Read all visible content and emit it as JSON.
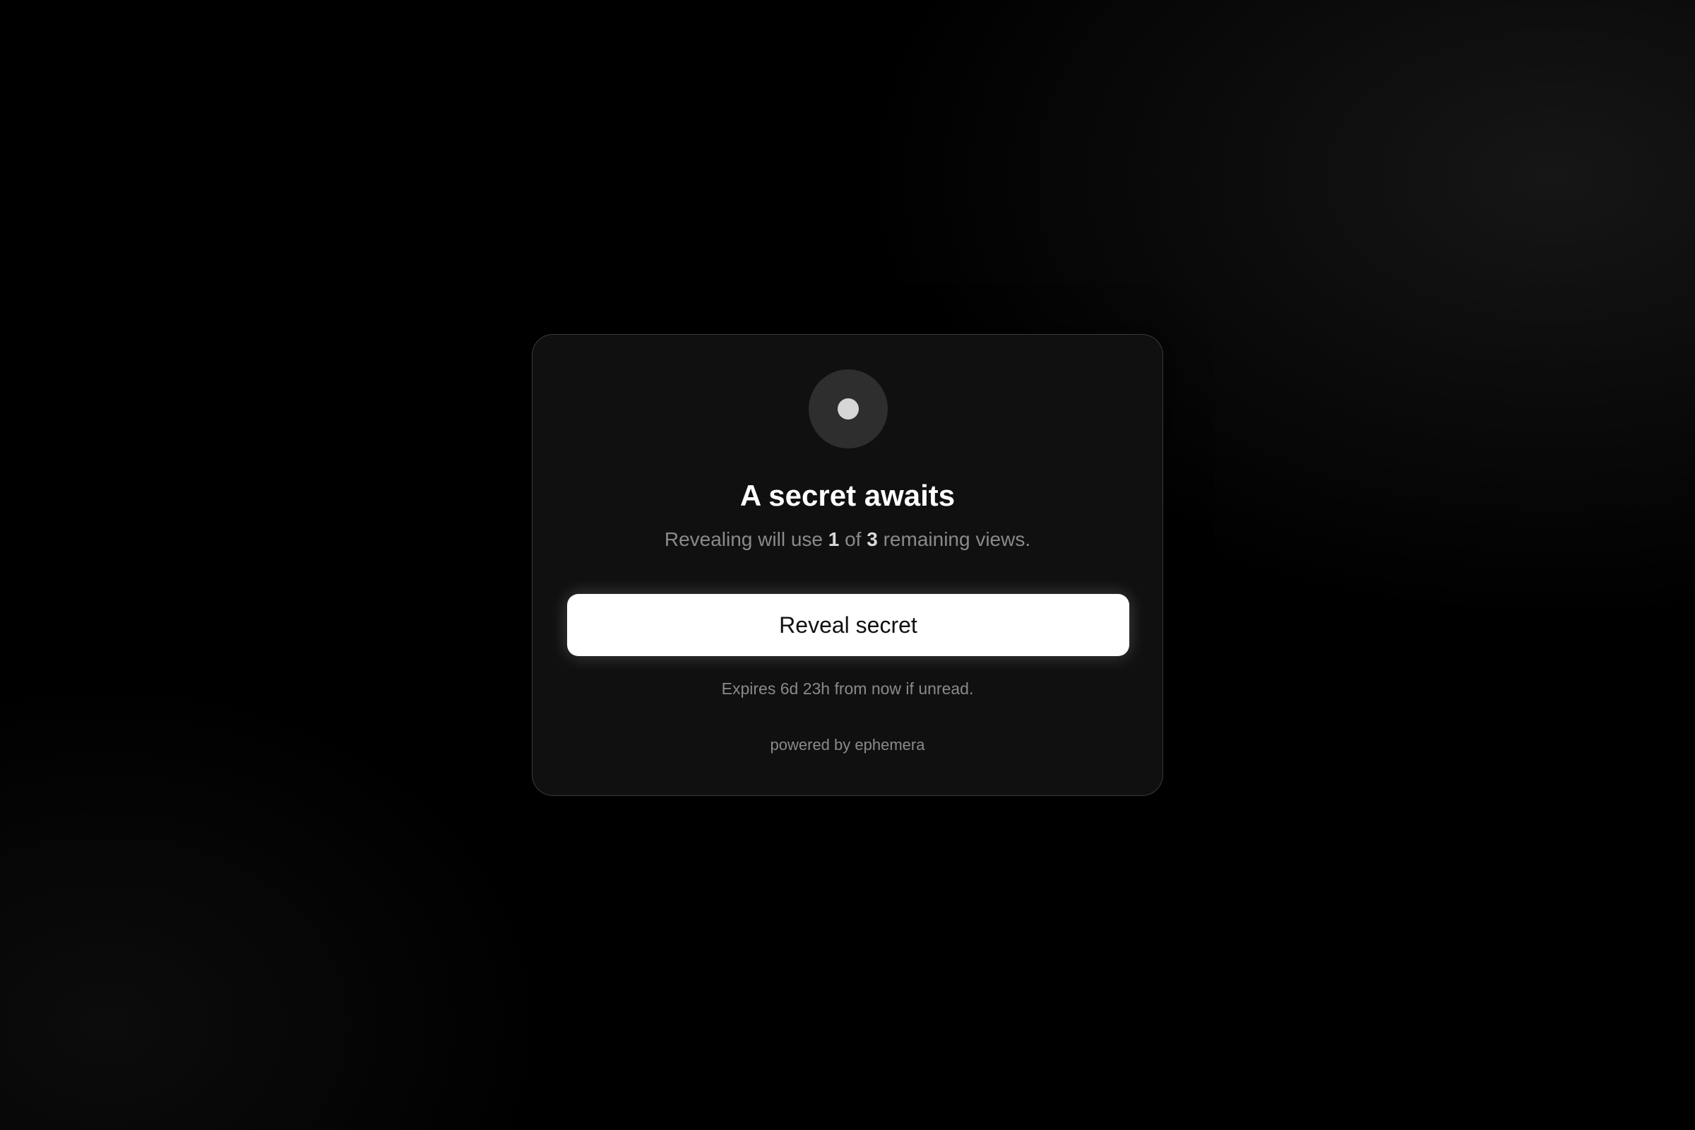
{
  "card": {
    "icon": "dot-icon",
    "title": "A secret awaits",
    "subtitle": {
      "prefix": "Revealing will use ",
      "used_views": "1",
      "middle": " of ",
      "remaining_views": "3",
      "suffix": " remaining views."
    },
    "reveal_button_label": "Reveal secret",
    "expires_text": "Expires 6d 23h from now if unread.",
    "powered_by": "powered by ephemera"
  },
  "colors": {
    "background": "#000000",
    "card_background": "#101010",
    "card_border": "#3a3a3a",
    "button_background": "#ffffff",
    "button_text": "#111111",
    "muted_text": "#8a8a8a",
    "title_text": "#ffffff"
  }
}
